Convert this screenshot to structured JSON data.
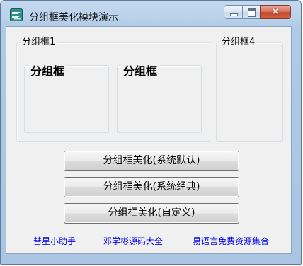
{
  "window": {
    "title": "分组框美化模块演示",
    "close_symbol": "✕"
  },
  "groups": {
    "group1_label": "分组框1",
    "inner_left_label": "分组框",
    "inner_right_label": "分组框",
    "group4_label": "分组框4"
  },
  "buttons": {
    "system_default": "分组框美化(系统默认)",
    "system_classic": "分组框美化(系统经典)",
    "custom": "分组框美化(自定义)"
  },
  "links": {
    "comet": "彗星小助手",
    "deng": "邓学彬源码大全",
    "eyuyan": "易语言免费资源集合"
  }
}
